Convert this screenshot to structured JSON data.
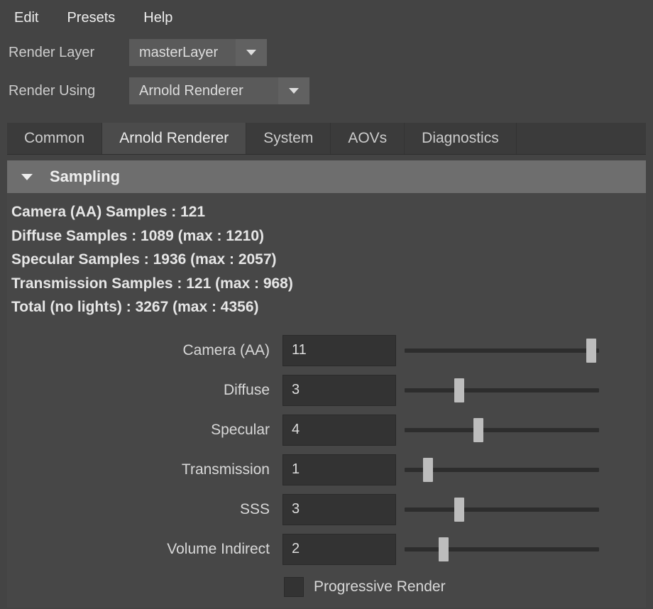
{
  "menu": {
    "edit": "Edit",
    "presets": "Presets",
    "help": "Help"
  },
  "form": {
    "render_layer_label": "Render Layer",
    "render_layer_value": "masterLayer",
    "render_using_label": "Render Using",
    "render_using_value": "Arnold Renderer"
  },
  "tabs": {
    "common": "Common",
    "arnold": "Arnold Renderer",
    "system": "System",
    "aovs": "AOVs",
    "diagnostics": "Diagnostics"
  },
  "section": {
    "title": "Sampling"
  },
  "stats": {
    "camera": "Camera (AA) Samples : 121",
    "diffuse": "Diffuse Samples : 1089 (max : 1210)",
    "specular": "Specular Samples : 1936 (max : 2057)",
    "transmission": "Transmission Samples : 121 (max : 968)",
    "total": "Total (no lights) : 3267 (max : 4356)"
  },
  "sliders": {
    "camera": {
      "label": "Camera (AA)",
      "value": "11",
      "pos": 96
    },
    "diffuse": {
      "label": "Diffuse",
      "value": "3",
      "pos": 28
    },
    "specular": {
      "label": "Specular",
      "value": "4",
      "pos": 38
    },
    "transmission": {
      "label": "Transmission",
      "value": "1",
      "pos": 12
    },
    "sss": {
      "label": "SSS",
      "value": "3",
      "pos": 28
    },
    "volume": {
      "label": "Volume Indirect",
      "value": "2",
      "pos": 20
    }
  },
  "progressive": {
    "label": "Progressive Render"
  }
}
